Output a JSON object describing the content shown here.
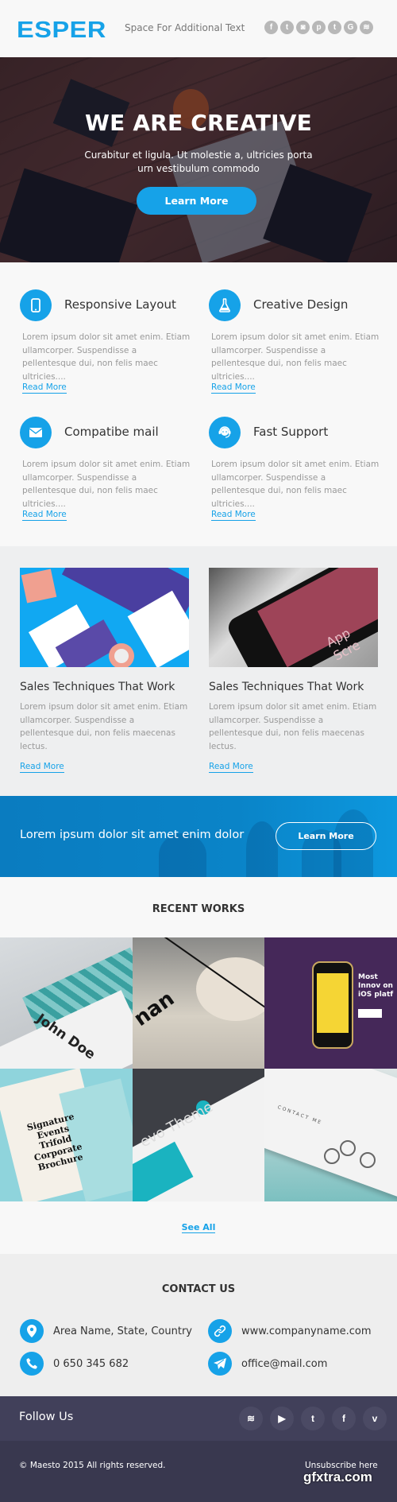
{
  "header": {
    "logo": "ESPER",
    "tagline": "Space For Additional Text",
    "social_icons": [
      {
        "name": "facebook-icon",
        "glyph": "f"
      },
      {
        "name": "twitter-icon",
        "glyph": "t"
      },
      {
        "name": "instagram-icon",
        "glyph": "◙"
      },
      {
        "name": "pinterest-icon",
        "glyph": "p"
      },
      {
        "name": "tumblr-icon",
        "glyph": "t"
      },
      {
        "name": "google-icon",
        "glyph": "G"
      },
      {
        "name": "rss-icon",
        "glyph": "≋"
      }
    ]
  },
  "hero": {
    "title": "WE ARE CREATIVE",
    "subtitle": "Curabitur et ligula. Ut molestie a, ultricies porta urn vestibulum commodo",
    "button": "Learn More"
  },
  "features": [
    {
      "title": "Responsive Layout",
      "icon": "mobile-icon",
      "text": "Lorem ipsum dolor sit amet enim. Etiam ullamcorper. Suspendisse a pellentesque dui, non felis maec ultricies....",
      "link": "Read More"
    },
    {
      "title": "Creative Design",
      "icon": "flask-icon",
      "text": "Lorem ipsum dolor sit amet enim. Etiam ullamcorper. Suspendisse a pellentesque dui, non felis maec ultricies....",
      "link": "Read More"
    },
    {
      "title": "Compatibe mail",
      "icon": "envelope-icon",
      "text": "Lorem ipsum dolor sit amet enim. Etiam ullamcorper. Suspendisse a pellentesque dui, non felis maec ultricies....",
      "link": "Read More"
    },
    {
      "title": "Fast Support",
      "icon": "support-icon",
      "text": "Lorem ipsum dolor sit amet enim. Etiam ullamcorper. Suspendisse a pellentesque dui, non felis maec ultricies....",
      "link": "Read More"
    }
  ],
  "posts": [
    {
      "title": "Sales Techniques That Work",
      "text": "Lorem ipsum dolor sit amet enim. Etiam ullamcorper. Suspendisse a pellentesque dui, non felis maecenas lectus.",
      "link": "Read More"
    },
    {
      "title": "Sales Techniques That Work",
      "text": "Lorem ipsum dolor sit amet enim. Etiam ullamcorper. Suspendisse a pellentesque dui, non felis maecenas lectus.",
      "link": "Read More",
      "image_text": "App Scre"
    }
  ],
  "cta": {
    "text": "Lorem ipsum dolor sit amet enim dolor",
    "button": "Learn More"
  },
  "recent_works": {
    "title": "RECENT WORKS",
    "see_all": "See All",
    "tiles": [
      {
        "caption": "John Doe"
      },
      {
        "caption": "nan"
      },
      {
        "caption": "Most Innov on iOS platf"
      },
      {
        "caption": "Signature Events Trifold Corporate Brochure"
      },
      {
        "caption": "evo Theme"
      },
      {
        "caption": "CONTACT ME"
      }
    ]
  },
  "contact": {
    "title": "CONTACT US",
    "address": "Area Name, State, Country",
    "website": "www.companyname.com",
    "phone": "0 650 345 682",
    "email": "office@mail.com"
  },
  "footer": {
    "follow_label": "Follow Us",
    "social_icons": [
      {
        "name": "rss-icon",
        "glyph": "≋"
      },
      {
        "name": "youtube-icon",
        "glyph": "▶"
      },
      {
        "name": "twitter-icon",
        "glyph": "t"
      },
      {
        "name": "facebook-icon",
        "glyph": "f"
      },
      {
        "name": "vimeo-icon",
        "glyph": "v"
      }
    ],
    "copyright": "© Maesto 2015 All rights reserved.",
    "unsubscribe": "Unsubscribe here",
    "watermark": "gfxtra.com"
  },
  "colors": {
    "accent": "#16a2e8",
    "footer_top": "#41405a",
    "footer_bottom": "#39384f"
  }
}
